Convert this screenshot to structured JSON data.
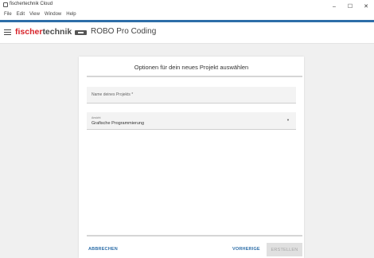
{
  "window": {
    "title": "fischertechnik Cloud",
    "controls": {
      "minimize": "–",
      "maximize": "☐",
      "close": "✕"
    }
  },
  "menubar": {
    "items": [
      "File",
      "Edit",
      "View",
      "Window",
      "Help"
    ]
  },
  "appbar": {
    "brand_red": "fischer",
    "brand_gray": "technik",
    "product": "ROBO Pro Coding"
  },
  "dialog": {
    "title": "Optionen für dein neues Projekt auswählen",
    "name_field": {
      "placeholder": "Name deines Projekts *"
    },
    "art_field": {
      "label": "Ansicht",
      "value": "Grafische Programmierung"
    },
    "buttons": {
      "cancel": "ABBRECHEN",
      "preview": "VORHERIGE",
      "create": "ERSTELLEN"
    }
  },
  "colors": {
    "accent": "#2d6ea8",
    "brand_red": "#d8232a",
    "disabled_bg": "#e0e0e0"
  }
}
